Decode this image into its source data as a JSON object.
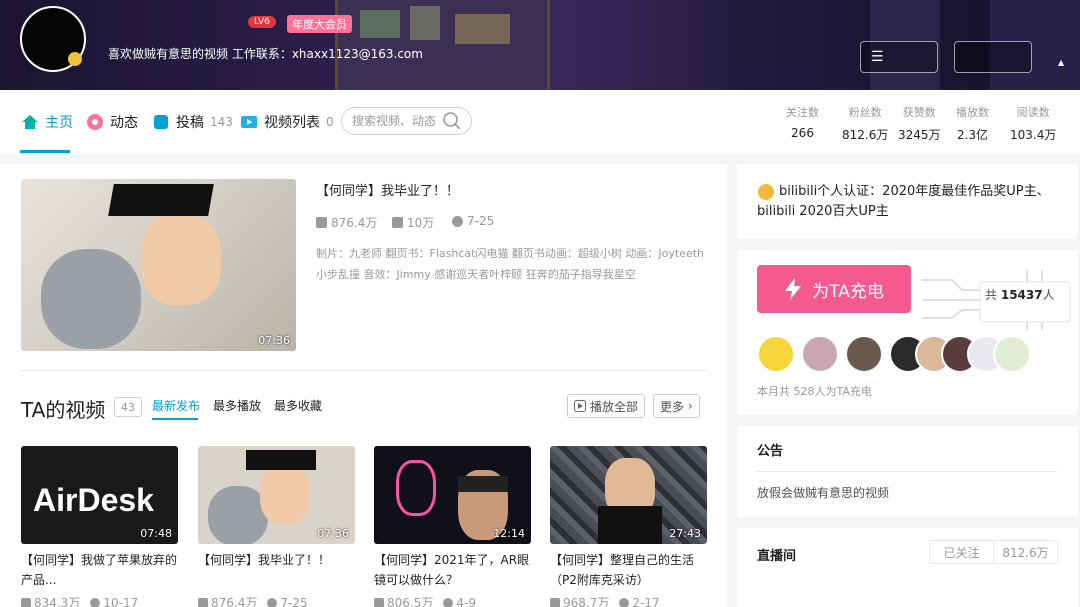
{
  "profile": {
    "level": "LV6",
    "vip_label": "年度大会员",
    "signature": "喜欢做贼有意思的视频 工作联系：xhaxx1123@163.com"
  },
  "nav": {
    "tabs": [
      {
        "label": "主页"
      },
      {
        "label": "动态"
      },
      {
        "label": "投稿",
        "count": "143"
      },
      {
        "label": "视频列表",
        "count": "0"
      }
    ],
    "search_placeholder": "搜索视频、动态"
  },
  "stats": [
    {
      "key": "关注数",
      "value": "266"
    },
    {
      "key": "粉丝数",
      "value": "812.6万"
    },
    {
      "key": "获赞数",
      "value": "3245万"
    },
    {
      "key": "播放数",
      "value": "2.3亿"
    },
    {
      "key": "阅读数",
      "value": "103.4万"
    }
  ],
  "featured": {
    "title": "【何同学】我毕业了！！",
    "duration": "07:36",
    "plays": "876.4万",
    "comments": "10万",
    "date": "7-25",
    "description": "制片：九老师 翻页书：Flashcat闪电猫 翻页书动画：超级小树 动画：Joyteeth 小步乱撞 音效：Jimmy 感谢巡天者叶梓颐 狂奔的茄子指导我星空"
  },
  "videos_section": {
    "title": "TA的视频",
    "count": "43",
    "sorts": [
      "最新发布",
      "最多播放",
      "最多收藏"
    ],
    "play_all": "播放全部",
    "more": "更多"
  },
  "videos": [
    {
      "title": "【何同学】我做了苹果放弃的产品...",
      "duration": "07:48",
      "plays": "834.3万",
      "date": "10-17",
      "overlay": "AirDesk",
      "bg": "#1a1a1a"
    },
    {
      "title": "【何同学】我毕业了！！",
      "duration": "07:36",
      "plays": "876.4万",
      "date": "7-25",
      "overlay": "",
      "bg": "#d9d4ca"
    },
    {
      "title": "【何同学】2021年了，AR眼镜可以做什么？",
      "duration": "12:14",
      "plays": "806.5万",
      "date": "4-9",
      "overlay": "",
      "bg": "#101018"
    },
    {
      "title": "【何同学】整理自己的生活（P2附库克采访）",
      "duration": "27:43",
      "plays": "968.7万",
      "date": "2-17",
      "overlay": "",
      "bg": "#3a3d44"
    }
  ],
  "certification": "bilibili个人认证：2020年度最佳作品奖UP主、bilibili 2020百大UP主",
  "charge": {
    "button": "为TA充电",
    "total_prefix": "共",
    "total_count": "15437",
    "total_suffix": "人",
    "month_text": "本月共 528人为TA充电"
  },
  "notice": {
    "title": "公告",
    "text": "放假会做贼有意思的视频"
  },
  "live": {
    "title": "直播间",
    "followed": "已关注",
    "fans": "812.6万"
  },
  "colors": {
    "accent": "#00a1d6",
    "pink": "#fb7299",
    "charge": "#f45a8d"
  }
}
